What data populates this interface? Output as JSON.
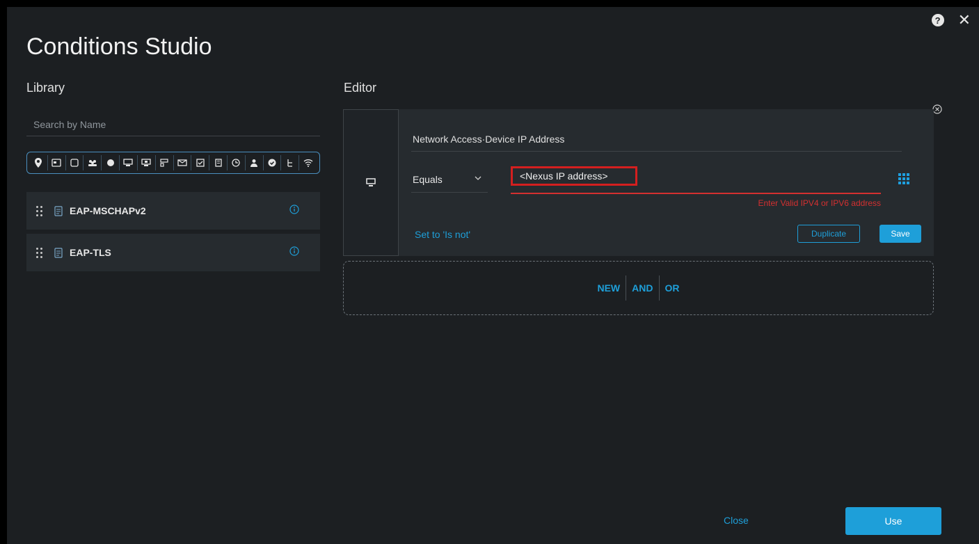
{
  "dialog": {
    "title": "Conditions Studio",
    "help_glyph": "?",
    "close_glyph": "✕"
  },
  "library": {
    "label": "Library",
    "search_placeholder": "Search by Name",
    "filter_icons": [
      "location-icon",
      "id-card-icon",
      "square-icon",
      "group-icon",
      "globe-icon",
      "monitor-icon",
      "screen-icon",
      "network-icon",
      "mail-icon",
      "doc-check-icon",
      "building-icon",
      "clock-icon",
      "user-icon",
      "check-circle-icon",
      "tree-icon",
      "wifi-icon"
    ],
    "items": [
      {
        "label": "EAP-MSCHAPv2"
      },
      {
        "label": "EAP-TLS"
      }
    ]
  },
  "editor": {
    "label": "Editor",
    "attribute": "Network Access·Device IP Address",
    "operator": "Equals",
    "value": "<Nexus IP address>",
    "error": "Enter Valid IPV4 or IPV6 address",
    "set_is_not": "Set to 'Is not'",
    "duplicate_label": "Duplicate",
    "save_label": "Save",
    "logic": {
      "new": "NEW",
      "and": "AND",
      "or": "OR"
    }
  },
  "footer": {
    "close_label": "Close",
    "use_label": "Use"
  },
  "colors": {
    "accent": "#1e9fd9",
    "error": "#d43030",
    "background": "#1c1f22"
  }
}
